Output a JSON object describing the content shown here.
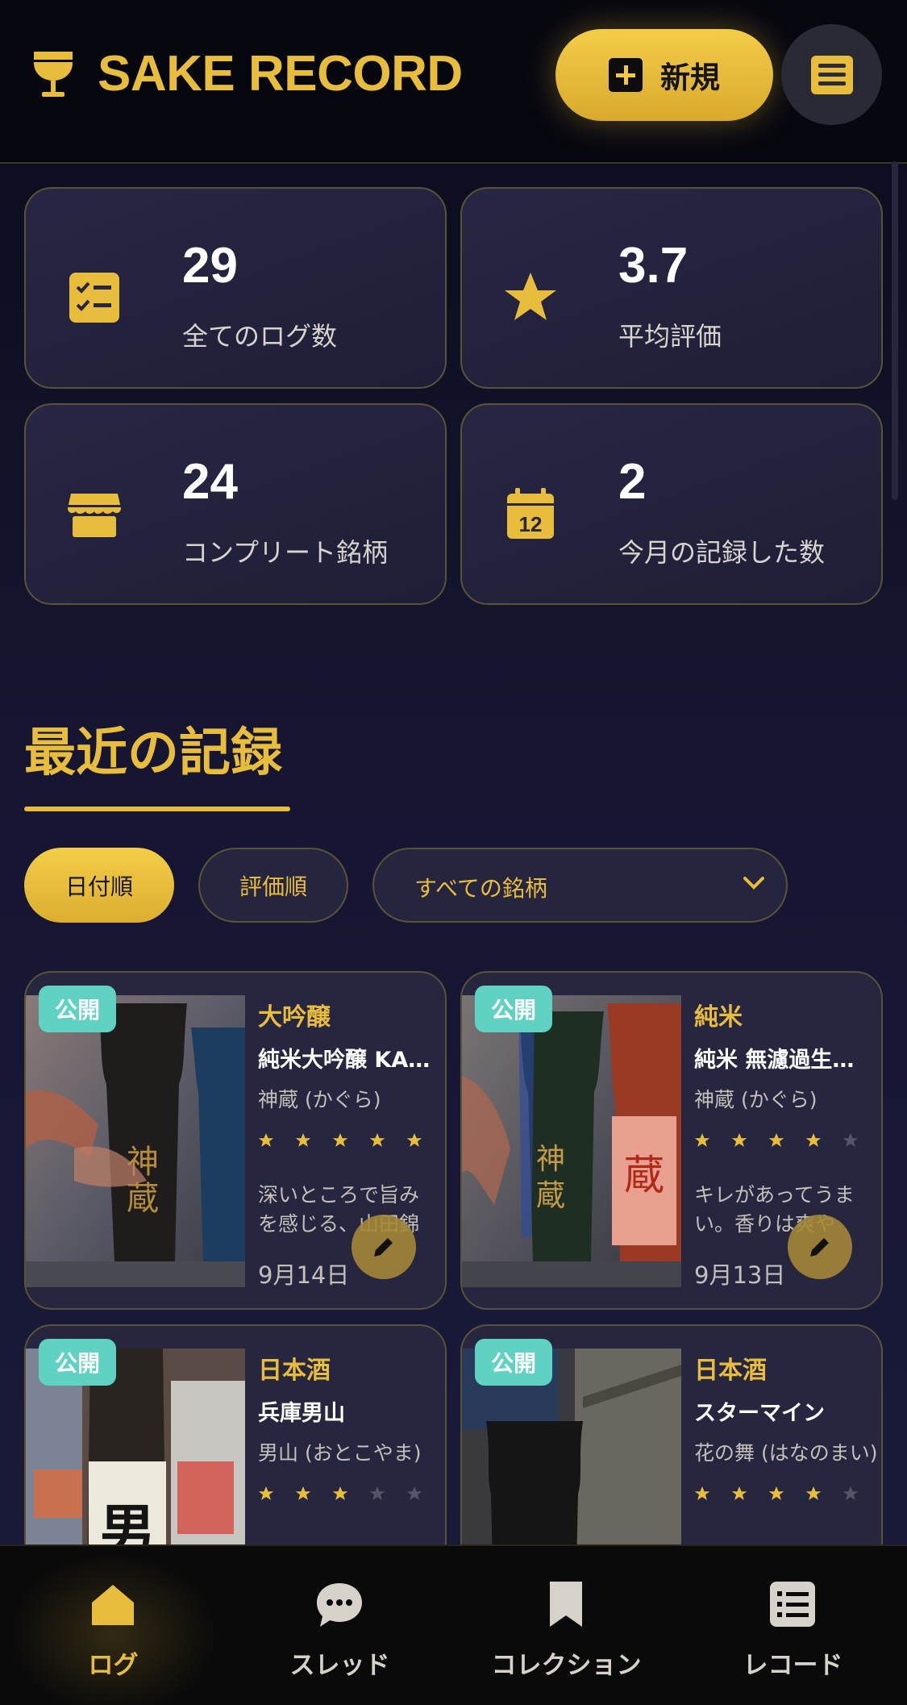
{
  "app": {
    "title": "SAKE RECORD",
    "new_label": "新規"
  },
  "stats": [
    {
      "value": "29",
      "label": "全てのログ数",
      "icon": "checklist-icon"
    },
    {
      "value": "3.7",
      "label": "平均評価",
      "icon": "star-icon"
    },
    {
      "value": "24",
      "label": "コンプリート銘柄",
      "icon": "store-icon"
    },
    {
      "value": "2",
      "label": "今月の記録した数",
      "icon": "calendar-icon"
    }
  ],
  "recent": {
    "title": "最近の記録",
    "sort_date": "日付順",
    "sort_rating": "評価順",
    "brand_filter": "すべての銘柄"
  },
  "records": [
    {
      "badge": "公開",
      "type": "大吟醸",
      "name": "純米大吟醸 KA…",
      "brand": "神蔵 (かぐら)",
      "rating": 5,
      "note": "深いところで旨みを感じる、山田錦を…",
      "date": "9月14日"
    },
    {
      "badge": "公開",
      "type": "純米",
      "name": "純米 無濾過生…",
      "brand": "神蔵 (かぐら)",
      "rating": 4,
      "note": "キレがあってうまい。香りは爽やか。",
      "date": "9月13日"
    },
    {
      "badge": "公開",
      "type": "日本酒",
      "name": "兵庫男山",
      "brand": "男山 (おとこやま)",
      "rating": 3,
      "note": "",
      "date": ""
    },
    {
      "badge": "公開",
      "type": "日本酒",
      "name": "スターマイン",
      "brand": "花の舞 (はなのまい)",
      "rating": 4,
      "note": "",
      "date": ""
    }
  ],
  "nav": [
    {
      "label": "ログ",
      "icon": "home-icon",
      "active": true
    },
    {
      "label": "スレッド",
      "icon": "chat-icon",
      "active": false
    },
    {
      "label": "コレクション",
      "icon": "bookmark-icon",
      "active": false
    },
    {
      "label": "レコード",
      "icon": "list-icon",
      "active": false
    }
  ],
  "colors": {
    "accent": "#e8bd3c",
    "badge": "#5fd2c4",
    "background": "#161633",
    "card": "#262640"
  }
}
